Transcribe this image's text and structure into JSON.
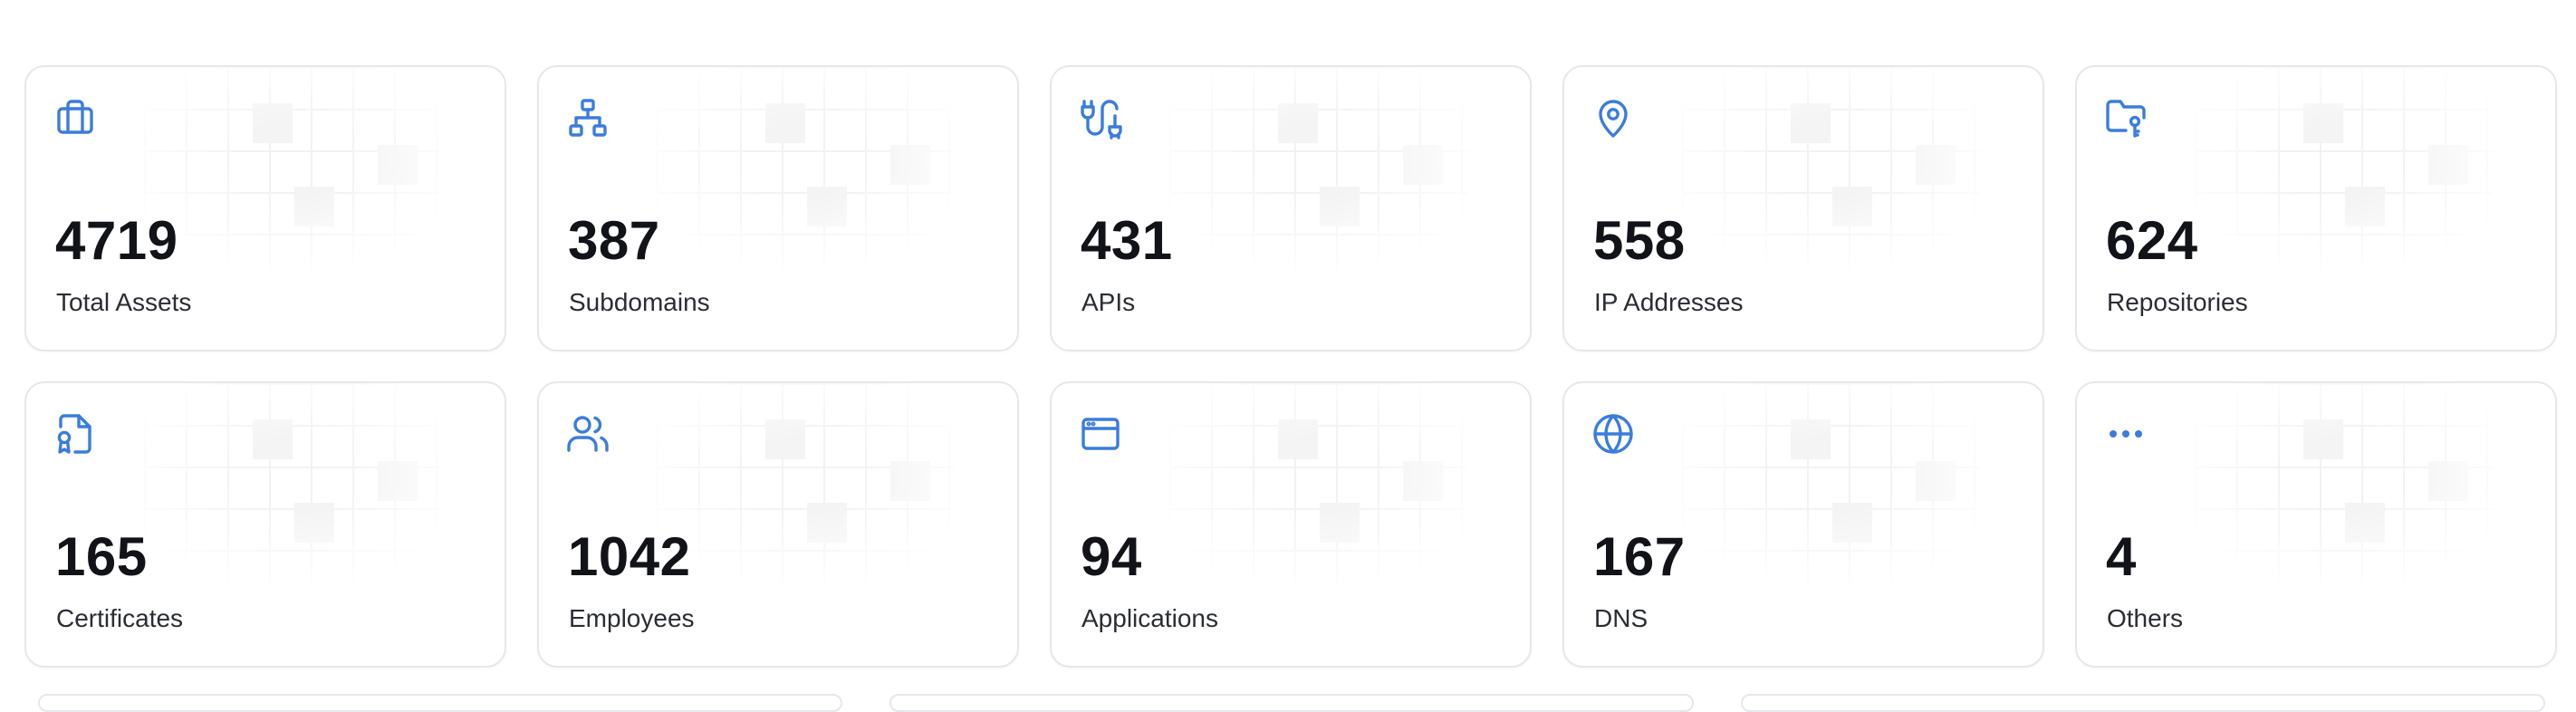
{
  "accent_color": "#3b7ddd",
  "stats": [
    {
      "icon": "briefcase-icon",
      "value": "4719",
      "label": "Total Assets"
    },
    {
      "icon": "sitemap-icon",
      "value": "387",
      "label": "Subdomains"
    },
    {
      "icon": "plug-icon",
      "value": "431",
      "label": "APIs"
    },
    {
      "icon": "map-pin-icon",
      "value": "558",
      "label": "IP Addresses"
    },
    {
      "icon": "folder-key-icon",
      "value": "624",
      "label": "Repositories"
    },
    {
      "icon": "certificate-icon",
      "value": "165",
      "label": "Certificates"
    },
    {
      "icon": "users-icon",
      "value": "1042",
      "label": "Employees"
    },
    {
      "icon": "browser-window-icon",
      "value": "94",
      "label": "Applications"
    },
    {
      "icon": "globe-icon",
      "value": "167",
      "label": "DNS"
    },
    {
      "icon": "dots-horizontal-icon",
      "value": "4",
      "label": "Others"
    }
  ]
}
